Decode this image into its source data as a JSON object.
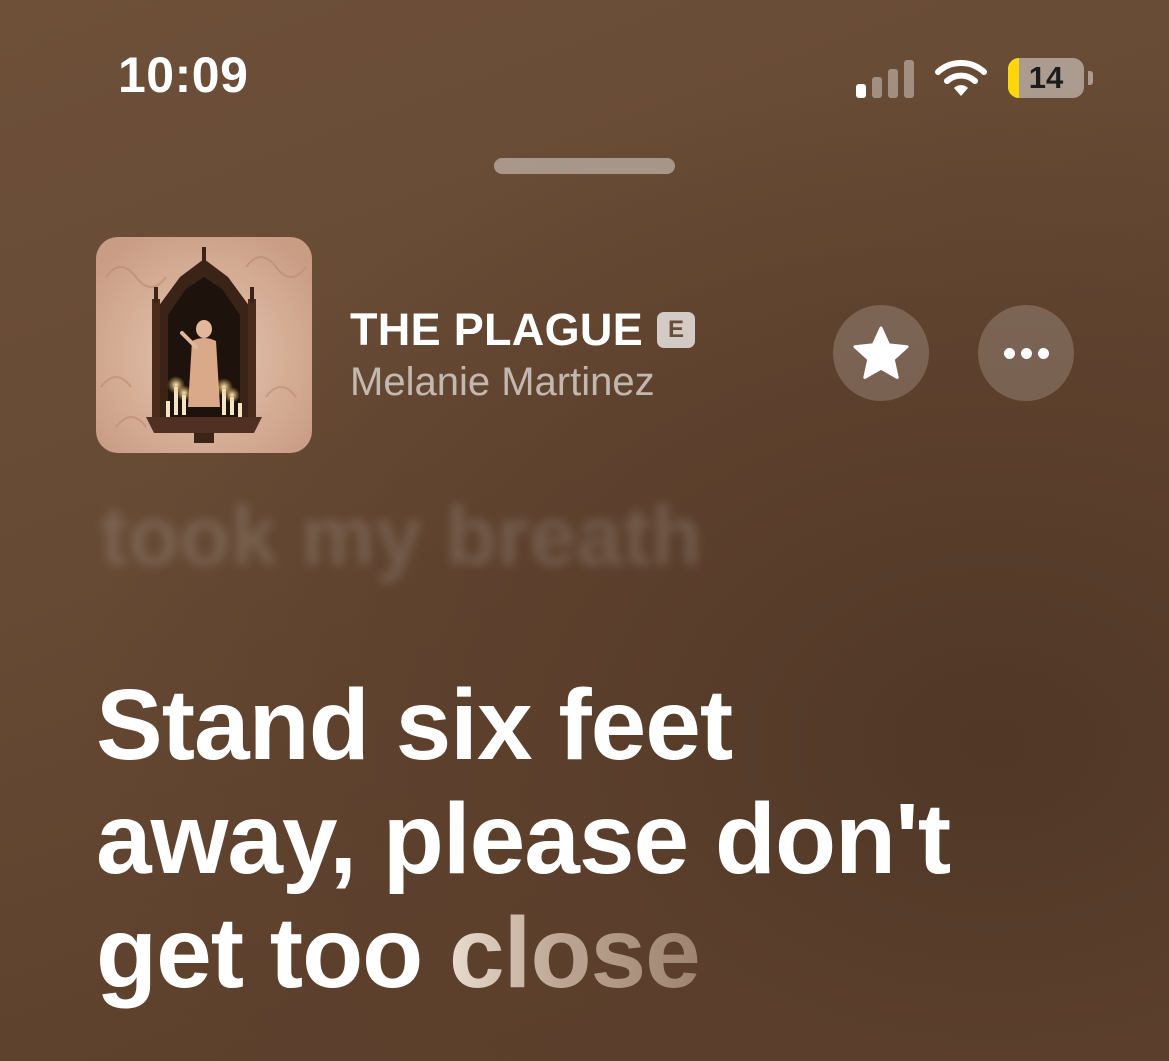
{
  "status_bar": {
    "time": "10:09",
    "signal_icon": "cellular-signal-icon",
    "signal_bars_active": 1,
    "signal_bars_total": 4,
    "wifi_icon": "wifi-icon",
    "battery_level": "14",
    "battery_color": "#ffd60a"
  },
  "sheet": {
    "grabber": "sheet-grabber"
  },
  "now_playing": {
    "title": "THE PLAGUE",
    "explicit_badge": "E",
    "artist": "Melanie Martinez",
    "artwork": "album-artwork",
    "favorite_icon": "star-icon",
    "more_icon": "ellipsis-icon"
  },
  "lyrics": {
    "previous_line": "took my breath",
    "current_lines": [
      "Stand six feet",
      "away, please don't"
    ],
    "current_last_sung": "get too ",
    "current_last_upcoming": "close"
  },
  "colors": {
    "background": "#664a34",
    "text": "#ffffff",
    "secondary_text": "#d6c4b4"
  }
}
